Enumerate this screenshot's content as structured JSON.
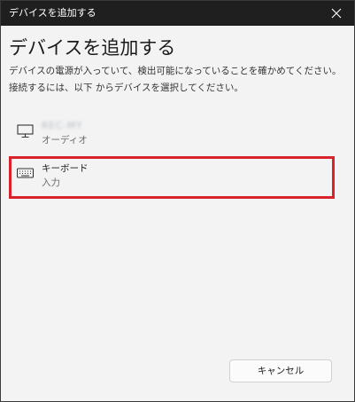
{
  "window": {
    "title": "デバイスを追加する"
  },
  "heading": "デバイスを追加する",
  "description": {
    "line1": "デバイスの電源が入っていて、検出可能になっていることを確かめてください。",
    "line2": "接続するには、以下 からデバイスを選択してください。"
  },
  "devices": [
    {
      "name": "REC-MY",
      "type": "オーディオ",
      "icon": "monitor-icon",
      "name_blurred": true
    },
    {
      "name": "キーボード",
      "type": "入力",
      "icon": "keyboard-icon",
      "selected": true
    }
  ],
  "buttons": {
    "cancel": "キャンセル"
  },
  "colors": {
    "titlebar": "#1f1f1f",
    "window_bg": "#f3f3f3",
    "highlight_border": "#d8232a"
  }
}
